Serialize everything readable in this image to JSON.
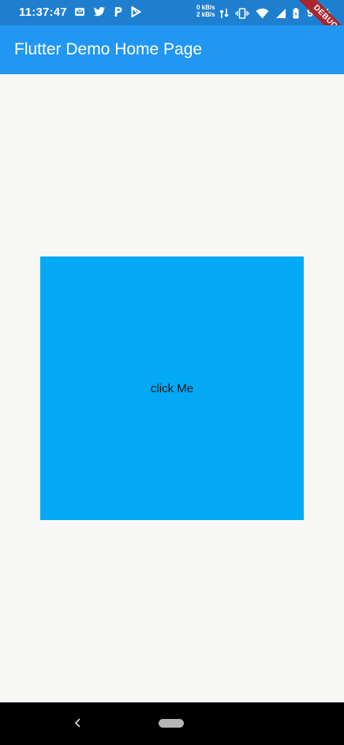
{
  "status_bar": {
    "time": "11:37:47",
    "netspeed_up": "0 kB/s",
    "netspeed_down": "2 kB/s",
    "battery_percent": "90%",
    "left_icons": [
      "mail-icon",
      "twitter-icon",
      "paypal-icon",
      "play-store-icon"
    ],
    "right_icons": [
      "data-transfer-icon",
      "vibrate-icon",
      "wifi-icon",
      "cell-signal-icon",
      "battery-icon"
    ]
  },
  "debug_banner": {
    "label": "DEBUG"
  },
  "app_bar": {
    "title": "Flutter Demo Home Page",
    "color": "#2196f3"
  },
  "main": {
    "button_label": "click Me",
    "button_color": "#03a9f4"
  },
  "nav_bar": {
    "icons": [
      "back-icon",
      "home-pill-icon"
    ]
  }
}
